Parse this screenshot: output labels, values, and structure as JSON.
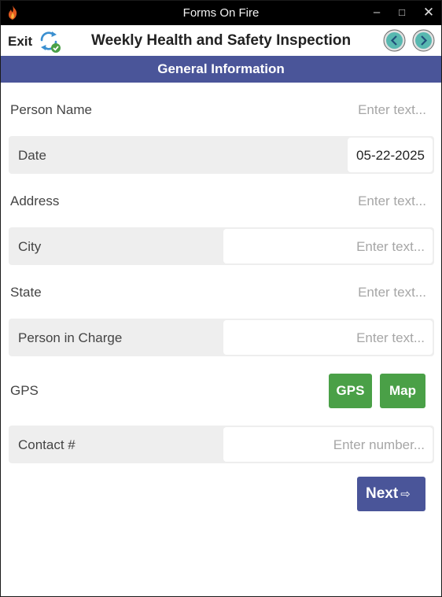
{
  "window": {
    "title": "Forms On Fire",
    "minimize": "–",
    "maximize": "□",
    "close": "✕"
  },
  "header": {
    "exit_label": "Exit",
    "form_title": "Weekly Health and Safety Inspection"
  },
  "section": {
    "title": "General Information"
  },
  "fields": {
    "person_name": {
      "label": "Person Name",
      "placeholder": "Enter text..."
    },
    "date": {
      "label": "Date",
      "value": "05-22-2025"
    },
    "address": {
      "label": "Address",
      "placeholder": "Enter text..."
    },
    "city": {
      "label": "City",
      "placeholder": "Enter text..."
    },
    "state": {
      "label": "State",
      "placeholder": "Enter text..."
    },
    "person_in_charge": {
      "label": "Person in Charge",
      "placeholder": "Enter text..."
    },
    "gps": {
      "label": "GPS",
      "gps_button": "GPS",
      "map_button": "Map"
    },
    "contact": {
      "label": "Contact #",
      "placeholder": "Enter number..."
    }
  },
  "footer": {
    "next_label": "Next",
    "next_arrow": "⇨"
  },
  "colors": {
    "section_bg": "#4a5599",
    "green_button": "#4aa047",
    "nav_button": "#58b8b0",
    "titlebar": "#000000"
  }
}
